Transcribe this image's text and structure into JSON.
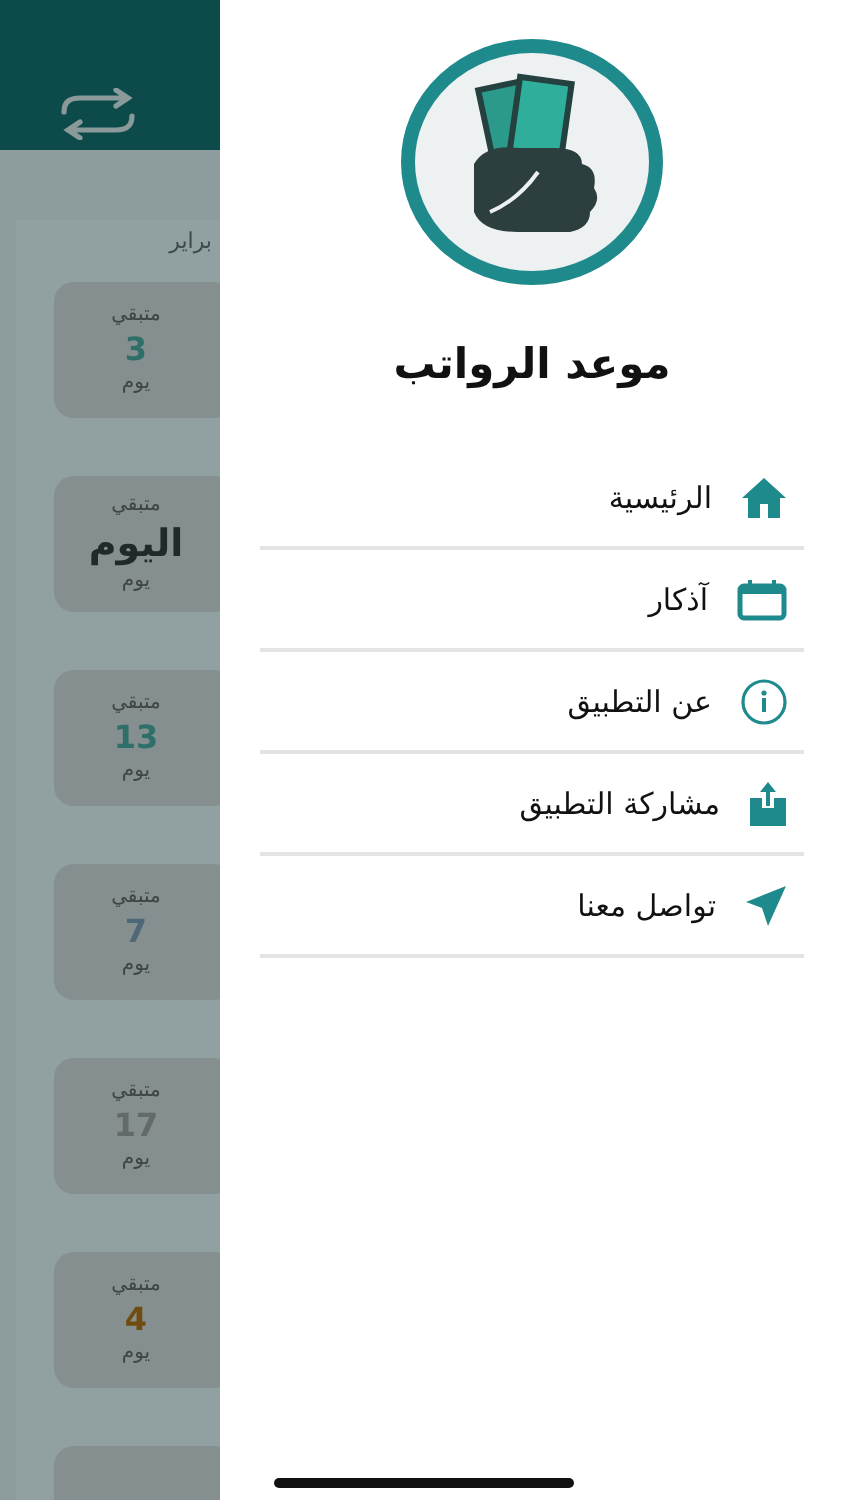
{
  "background": {
    "month": "براير",
    "cards": [
      {
        "top": "متبقي",
        "value": "3",
        "unit": "يوم",
        "color": "#2f6f6a",
        "kind": "number"
      },
      {
        "top": "متبقي",
        "value": "اليوم",
        "unit": "يوم",
        "color": "#1f2a2a",
        "kind": "word"
      },
      {
        "top": "متبقي",
        "value": "13",
        "unit": "يوم",
        "color": "#2f6f6a",
        "kind": "number"
      },
      {
        "top": "متبقي",
        "value": "7",
        "unit": "يوم",
        "color": "#4f6878",
        "kind": "number"
      },
      {
        "top": "متبقي",
        "value": "17",
        "unit": "يوم",
        "color": "#626a6a",
        "kind": "number"
      },
      {
        "top": "متبقي",
        "value": "4",
        "unit": "يوم",
        "color": "#704c10",
        "kind": "number"
      }
    ]
  },
  "drawer": {
    "title": "موعد الرواتب",
    "items": [
      {
        "label": "الرئيسية",
        "kind": "home"
      },
      {
        "label": "آذكار",
        "kind": "calendar"
      },
      {
        "label": "عن التطبيق",
        "kind": "info"
      },
      {
        "label": "مشاركة التطبيق",
        "kind": "share"
      },
      {
        "label": "تواصل معنا",
        "kind": "send"
      }
    ]
  }
}
